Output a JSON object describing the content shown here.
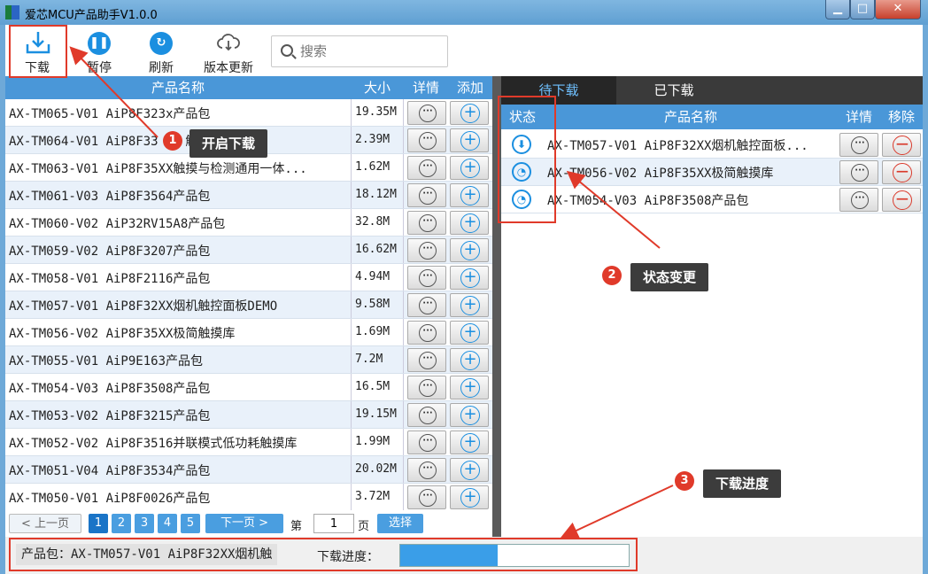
{
  "window": {
    "title": "爱芯MCU产品助手V1.0.0",
    "min": "▁",
    "max": "□",
    "close": "✕"
  },
  "toolbar": {
    "download": "下载",
    "pause": "暂停",
    "refresh": "刷新",
    "update": "版本更新",
    "download_icon": "download-icon",
    "pause_icon": "pause-icon",
    "refresh_icon": "refresh-icon",
    "update_icon": "cloud-download-icon"
  },
  "search": {
    "placeholder": "搜索"
  },
  "product_table": {
    "headers": {
      "name": "产品名称",
      "size": "大小",
      "detail": "详情",
      "add": "添加"
    },
    "rows": [
      {
        "name": "AX-TM065-V01 AiP8F323x产品包",
        "size": "19.35M"
      },
      {
        "name": "AX-TM064-V01 AiP8F33  管  触摸库产品包",
        "size": "2.39M"
      },
      {
        "name": "AX-TM063-V01 AiP8F35XX触摸与检测通用一体...",
        "size": "1.62M"
      },
      {
        "name": "AX-TM061-V03 AiP8F3564产品包",
        "size": "18.12M"
      },
      {
        "name": "AX-TM060-V02 AiP32RV15A8产品包",
        "size": "32.8M"
      },
      {
        "name": "AX-TM059-V02 AiP8F3207产品包",
        "size": "16.62M"
      },
      {
        "name": "AX-TM058-V01 AiP8F2116产品包",
        "size": "4.94M"
      },
      {
        "name": "AX-TM057-V01 AiP8F32XX烟机触控面板DEMO",
        "size": "9.58M"
      },
      {
        "name": "AX-TM056-V02 AiP8F35XX极简触摸库",
        "size": "1.69M"
      },
      {
        "name": "AX-TM055-V01 AiP9E163产品包",
        "size": "7.2M"
      },
      {
        "name": "AX-TM054-V03 AiP8F3508产品包",
        "size": "16.5M"
      },
      {
        "name": "AX-TM053-V02 AiP8F3215产品包",
        "size": "19.15M"
      },
      {
        "name": "AX-TM052-V02 AiP8F3516并联模式低功耗触摸库",
        "size": "1.99M"
      },
      {
        "name": "AX-TM051-V04 AiP8F3534产品包",
        "size": "20.02M"
      },
      {
        "name": "AX-TM050-V01 AiP8F0026产品包",
        "size": "3.72M"
      }
    ]
  },
  "pager": {
    "prev": "< 上一页",
    "pages": [
      "1",
      "2",
      "3",
      "4",
      "5"
    ],
    "next": "下一页 >",
    "di": "第",
    "page_value": "1",
    "ye": "页",
    "select": "选择"
  },
  "download_panel": {
    "tabs": [
      "待下载",
      "已下载"
    ],
    "headers": {
      "status": "状态",
      "name": "产品名称",
      "detail": "详情",
      "remove": "移除"
    },
    "rows": [
      {
        "status_icon": "download-icon",
        "status": "⬇",
        "name": "AX-TM057-V01 AiP8F32XX烟机触控面板..."
      },
      {
        "status_icon": "clock-icon",
        "status": "◔",
        "name": "AX-TM056-V02 AiP8F35XX极简触摸库"
      },
      {
        "status_icon": "clock-icon",
        "status": "◔",
        "name": "AX-TM054-V03 AiP8F3508产品包"
      }
    ]
  },
  "statusbar": {
    "package": "产品包：AX-TM057-V01 AiP8F32XX烟机触",
    "progress_label": "下载进度：",
    "progress_text": "42.8%",
    "progress_value": 42.8
  },
  "annotations": {
    "c1": {
      "num": "1",
      "text": "开启下载"
    },
    "c2": {
      "num": "2",
      "text": "状态变更"
    },
    "c3": {
      "num": "3",
      "text": "下载进度"
    },
    "color": "#e03a2a"
  }
}
